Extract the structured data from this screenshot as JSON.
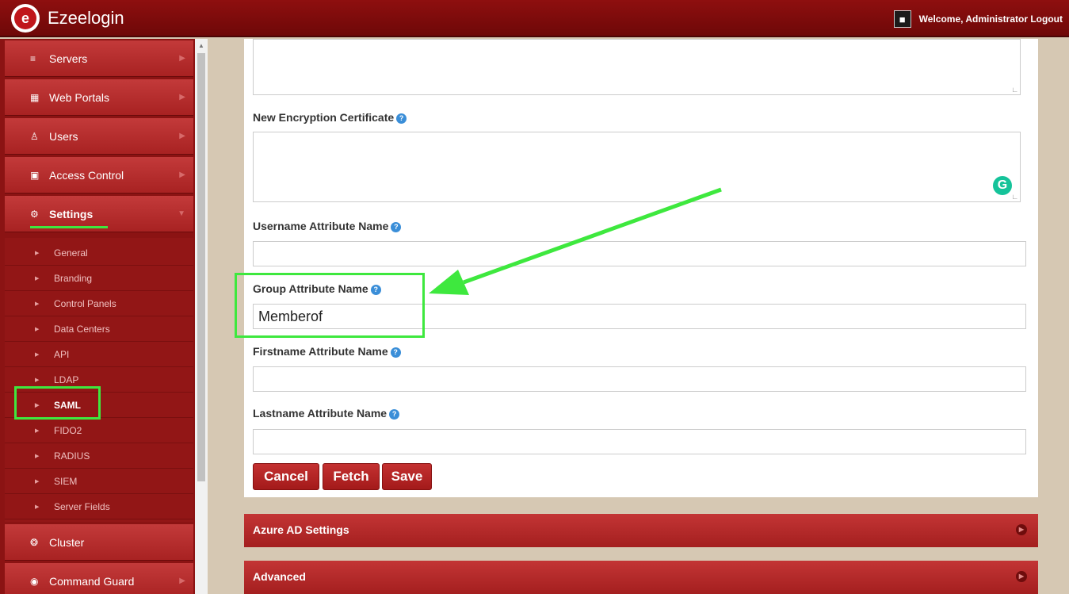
{
  "app": {
    "name": "Ezeelogin",
    "logo_letter": "e"
  },
  "header": {
    "welcome": "Welcome, Administrator Logout"
  },
  "sidebar": {
    "items": [
      {
        "label": "Servers",
        "icon": "list-icon"
      },
      {
        "label": "Web Portals",
        "icon": "grid-icon"
      },
      {
        "label": "Users",
        "icon": "users-icon"
      },
      {
        "label": "Access Control",
        "icon": "lock-icon"
      },
      {
        "label": "Settings",
        "icon": "gears-icon"
      },
      {
        "label": "Cluster",
        "icon": "globe-icon"
      },
      {
        "label": "Command Guard",
        "icon": "shield-icon"
      }
    ],
    "submenu": [
      "General",
      "Branding",
      "Control Panels",
      "Data Centers",
      "API",
      "LDAP",
      "SAML",
      "FIDO2",
      "RADIUS",
      "SIEM",
      "Server Fields"
    ]
  },
  "form": {
    "enc_cert_label": "New Encryption Certificate",
    "username_attr_label": "Username Attribute Name",
    "username_attr_value": "",
    "group_attr_label": "Group Attribute Name",
    "group_attr_value": "Memberof",
    "firstname_attr_label": "Firstname Attribute Name",
    "firstname_attr_value": "",
    "lastname_attr_label": "Lastname Attribute Name",
    "lastname_attr_value": "",
    "help_glyph": "?"
  },
  "buttons": {
    "cancel": "Cancel",
    "fetch": "Fetch",
    "save": "Save"
  },
  "sections": {
    "azure": "Azure AD Settings",
    "advanced": "Advanced"
  },
  "colors": {
    "brand_red": "#a82222",
    "highlight_green": "#3ee83e",
    "header_red": "#7e0b0b"
  }
}
